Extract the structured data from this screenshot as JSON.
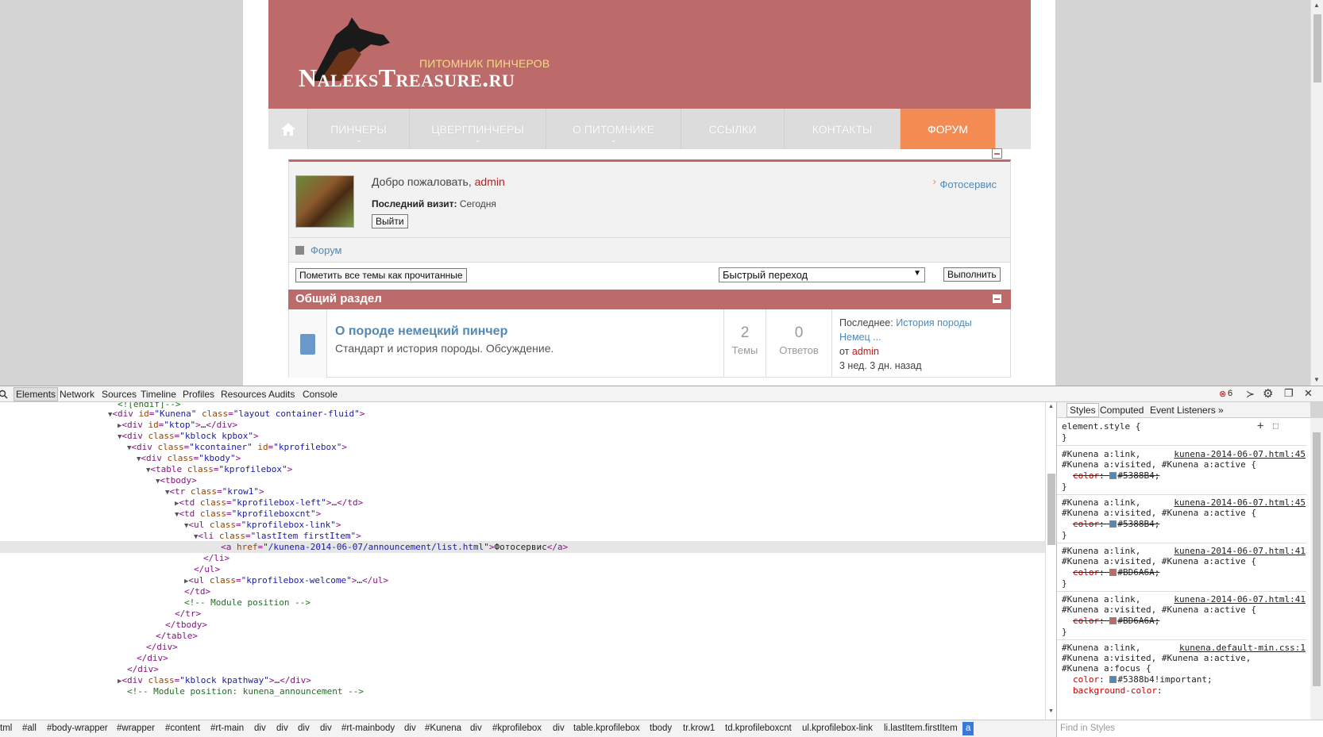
{
  "site": {
    "tagline": "ПИТОМНИК ПИНЧЕРОВ",
    "logo_text": "NaleksTreasure.ru"
  },
  "nav": {
    "items": [
      {
        "label": "ПИНЧЕРЫ",
        "caret": true
      },
      {
        "label": "ЦВЕРГПИНЧЕРЫ",
        "caret": true
      },
      {
        "label": "О ПИТОМНИКЕ",
        "caret": true
      },
      {
        "label": "ССЫЛКИ",
        "caret": false
      },
      {
        "label": "КОНТАКТЫ",
        "caret": false
      },
      {
        "label": "ФОРУМ",
        "caret": false
      }
    ]
  },
  "profile": {
    "welcome_prefix": "Добро пожаловать,",
    "username": "admin",
    "lastvisit_label": "Последний визит:",
    "lastvisit_value": "Сегодня",
    "logout_label": "Выйти",
    "photo_link": "Фотосервис"
  },
  "pathway": {
    "label": "Форум"
  },
  "actions": {
    "mark_read": "Пометить все темы как прочитанные",
    "quick_jump": "Быстрый переход",
    "go": "Выполнить"
  },
  "section": {
    "title": "Общий раздел",
    "category": {
      "title": "О породе немецкий пинчер",
      "desc": "Стандарт и история породы. Обсуждение.",
      "topics": "2",
      "topics_label": "Темы",
      "replies": "0",
      "replies_label": "Ответов",
      "last_prefix": "Последнее:",
      "last_link_1": "История породы",
      "last_link_2": "Немец ...",
      "by_prefix": "от",
      "by_user": "admin",
      "ago": "3 нед. 3 дн. назад"
    }
  },
  "devtools": {
    "tabs": [
      "Elements",
      "Network",
      "Sources",
      "Timeline",
      "Profiles",
      "Resources",
      "Audits",
      "Console"
    ],
    "error_count": "6",
    "styles_tabs": [
      "Styles",
      "Computed",
      "Event Listeners",
      "»"
    ],
    "find_placeholder": "Find in Styles",
    "breadcrumbs": [
      "tml",
      "#all",
      "#body-wrapper",
      "#wrapper",
      "#content",
      "#rt-main",
      "div",
      "div",
      "div",
      "div",
      "#rt-mainbody",
      "div",
      "#Kunena",
      "div",
      "#kprofilebox",
      "div",
      "table.kprofilebox",
      "tbody",
      "tr.krow1",
      "td.kprofileboxcnt",
      "ul.kprofilebox-link",
      "li.lastItem.firstItem",
      "a"
    ]
  },
  "colors": {
    "brand": "#bd6a6a",
    "accent": "#f48b52",
    "link": "#5388b4",
    "user": "#c51818"
  }
}
